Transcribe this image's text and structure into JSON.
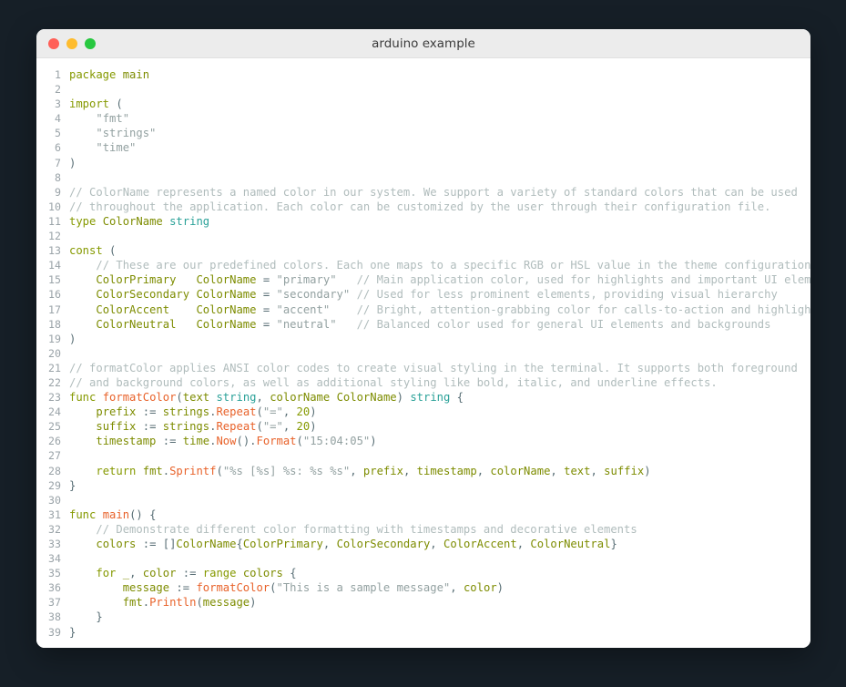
{
  "window": {
    "title": "arduino example",
    "controls": [
      {
        "name": "close-button",
        "color": "#ff5f57"
      },
      {
        "name": "minimize-button",
        "color": "#febc2e"
      },
      {
        "name": "maximize-button",
        "color": "#28c840"
      }
    ]
  },
  "theme": {
    "background": "#161f27",
    "titlebar": "#ececec",
    "editor_background": "#ffffff",
    "line_number": "#9aa3a8",
    "keyword": "#859900",
    "identifier": "#7d8c00",
    "builtin_type": "#2aa198",
    "function": "#e8622a",
    "string": "#93a1a1",
    "comment": "#b0bcbc",
    "punctuation": "#586e75"
  },
  "editor": {
    "language": "go",
    "first_line": 1,
    "last_line": 39,
    "lines": [
      {
        "n": 1,
        "tokens": [
          {
            "t": "package",
            "c": "kw"
          },
          {
            "t": " ",
            "c": "pun"
          },
          {
            "t": "main",
            "c": "id"
          }
        ]
      },
      {
        "n": 2,
        "tokens": []
      },
      {
        "n": 3,
        "tokens": [
          {
            "t": "import",
            "c": "kw"
          },
          {
            "t": " (",
            "c": "pun"
          }
        ]
      },
      {
        "n": 4,
        "tokens": [
          {
            "t": "    ",
            "c": "pun"
          },
          {
            "t": "\"fmt\"",
            "c": "str"
          }
        ]
      },
      {
        "n": 5,
        "tokens": [
          {
            "t": "    ",
            "c": "pun"
          },
          {
            "t": "\"strings\"",
            "c": "str"
          }
        ]
      },
      {
        "n": 6,
        "tokens": [
          {
            "t": "    ",
            "c": "pun"
          },
          {
            "t": "\"time\"",
            "c": "str"
          }
        ]
      },
      {
        "n": 7,
        "tokens": [
          {
            "t": ")",
            "c": "pun"
          }
        ]
      },
      {
        "n": 8,
        "tokens": []
      },
      {
        "n": 9,
        "tokens": [
          {
            "t": "// ColorName represents a named color in our system. We support a variety of standard colors that can be used",
            "c": "cmt"
          }
        ]
      },
      {
        "n": 10,
        "tokens": [
          {
            "t": "// throughout the application. Each color can be customized by the user through their configuration file.",
            "c": "cmt"
          }
        ]
      },
      {
        "n": 11,
        "tokens": [
          {
            "t": "type",
            "c": "kw"
          },
          {
            "t": " ",
            "c": "pun"
          },
          {
            "t": "ColorName",
            "c": "typ"
          },
          {
            "t": " ",
            "c": "pun"
          },
          {
            "t": "string",
            "c": "bt"
          }
        ]
      },
      {
        "n": 12,
        "tokens": []
      },
      {
        "n": 13,
        "tokens": [
          {
            "t": "const",
            "c": "kw"
          },
          {
            "t": " (",
            "c": "pun"
          }
        ]
      },
      {
        "n": 14,
        "tokens": [
          {
            "t": "    ",
            "c": "pun"
          },
          {
            "t": "// These are our predefined colors. Each one maps to a specific RGB or HSL value in the theme configuration.",
            "c": "cmt"
          }
        ]
      },
      {
        "n": 15,
        "tokens": [
          {
            "t": "    ",
            "c": "pun"
          },
          {
            "t": "ColorPrimary",
            "c": "id"
          },
          {
            "t": "   ",
            "c": "pun"
          },
          {
            "t": "ColorName",
            "c": "typ"
          },
          {
            "t": " = ",
            "c": "pun"
          },
          {
            "t": "\"primary\"",
            "c": "str"
          },
          {
            "t": "   ",
            "c": "pun"
          },
          {
            "t": "// Main application color, used for highlights and important UI elements",
            "c": "cmt"
          }
        ]
      },
      {
        "n": 16,
        "tokens": [
          {
            "t": "    ",
            "c": "pun"
          },
          {
            "t": "ColorSecondary",
            "c": "id"
          },
          {
            "t": " ",
            "c": "pun"
          },
          {
            "t": "ColorName",
            "c": "typ"
          },
          {
            "t": " = ",
            "c": "pun"
          },
          {
            "t": "\"secondary\"",
            "c": "str"
          },
          {
            "t": " ",
            "c": "pun"
          },
          {
            "t": "// Used for less prominent elements, providing visual hierarchy",
            "c": "cmt"
          }
        ]
      },
      {
        "n": 17,
        "tokens": [
          {
            "t": "    ",
            "c": "pun"
          },
          {
            "t": "ColorAccent",
            "c": "id"
          },
          {
            "t": "    ",
            "c": "pun"
          },
          {
            "t": "ColorName",
            "c": "typ"
          },
          {
            "t": " = ",
            "c": "pun"
          },
          {
            "t": "\"accent\"",
            "c": "str"
          },
          {
            "t": "    ",
            "c": "pun"
          },
          {
            "t": "// Bright, attention-grabbing color for calls-to-action and highlights",
            "c": "cmt"
          }
        ]
      },
      {
        "n": 18,
        "tokens": [
          {
            "t": "    ",
            "c": "pun"
          },
          {
            "t": "ColorNeutral",
            "c": "id"
          },
          {
            "t": "   ",
            "c": "pun"
          },
          {
            "t": "ColorName",
            "c": "typ"
          },
          {
            "t": " = ",
            "c": "pun"
          },
          {
            "t": "\"neutral\"",
            "c": "str"
          },
          {
            "t": "   ",
            "c": "pun"
          },
          {
            "t": "// Balanced color used for general UI elements and backgrounds",
            "c": "cmt"
          }
        ]
      },
      {
        "n": 19,
        "tokens": [
          {
            "t": ")",
            "c": "pun"
          }
        ]
      },
      {
        "n": 20,
        "tokens": []
      },
      {
        "n": 21,
        "tokens": [
          {
            "t": "// formatColor applies ANSI color codes to create visual styling in the terminal. It supports both foreground",
            "c": "cmt"
          }
        ]
      },
      {
        "n": 22,
        "tokens": [
          {
            "t": "// and background colors, as well as additional styling like bold, italic, and underline effects.",
            "c": "cmt"
          }
        ]
      },
      {
        "n": 23,
        "tokens": [
          {
            "t": "func",
            "c": "kw"
          },
          {
            "t": " ",
            "c": "pun"
          },
          {
            "t": "formatColor",
            "c": "fn"
          },
          {
            "t": "(",
            "c": "pun"
          },
          {
            "t": "text",
            "c": "id"
          },
          {
            "t": " ",
            "c": "pun"
          },
          {
            "t": "string",
            "c": "bt"
          },
          {
            "t": ", ",
            "c": "pun"
          },
          {
            "t": "colorName",
            "c": "id"
          },
          {
            "t": " ",
            "c": "pun"
          },
          {
            "t": "ColorName",
            "c": "typ"
          },
          {
            "t": ") ",
            "c": "pun"
          },
          {
            "t": "string",
            "c": "bt"
          },
          {
            "t": " {",
            "c": "pun"
          }
        ]
      },
      {
        "n": 24,
        "tokens": [
          {
            "t": "    ",
            "c": "pun"
          },
          {
            "t": "prefix",
            "c": "id"
          },
          {
            "t": " := ",
            "c": "pun"
          },
          {
            "t": "strings",
            "c": "id"
          },
          {
            "t": ".",
            "c": "pun"
          },
          {
            "t": "Repeat",
            "c": "fn"
          },
          {
            "t": "(",
            "c": "pun"
          },
          {
            "t": "\"=\"",
            "c": "str"
          },
          {
            "t": ", ",
            "c": "pun"
          },
          {
            "t": "20",
            "c": "num"
          },
          {
            "t": ")",
            "c": "pun"
          }
        ]
      },
      {
        "n": 25,
        "tokens": [
          {
            "t": "    ",
            "c": "pun"
          },
          {
            "t": "suffix",
            "c": "id"
          },
          {
            "t": " := ",
            "c": "pun"
          },
          {
            "t": "strings",
            "c": "id"
          },
          {
            "t": ".",
            "c": "pun"
          },
          {
            "t": "Repeat",
            "c": "fn"
          },
          {
            "t": "(",
            "c": "pun"
          },
          {
            "t": "\"=\"",
            "c": "str"
          },
          {
            "t": ", ",
            "c": "pun"
          },
          {
            "t": "20",
            "c": "num"
          },
          {
            "t": ")",
            "c": "pun"
          }
        ]
      },
      {
        "n": 26,
        "tokens": [
          {
            "t": "    ",
            "c": "pun"
          },
          {
            "t": "timestamp",
            "c": "id"
          },
          {
            "t": " := ",
            "c": "pun"
          },
          {
            "t": "time",
            "c": "id"
          },
          {
            "t": ".",
            "c": "pun"
          },
          {
            "t": "Now",
            "c": "fn"
          },
          {
            "t": "().",
            "c": "pun"
          },
          {
            "t": "Format",
            "c": "fn"
          },
          {
            "t": "(",
            "c": "pun"
          },
          {
            "t": "\"15:04:05\"",
            "c": "str"
          },
          {
            "t": ")",
            "c": "pun"
          }
        ]
      },
      {
        "n": 27,
        "tokens": []
      },
      {
        "n": 28,
        "tokens": [
          {
            "t": "    ",
            "c": "pun"
          },
          {
            "t": "return",
            "c": "kw"
          },
          {
            "t": " ",
            "c": "pun"
          },
          {
            "t": "fmt",
            "c": "id"
          },
          {
            "t": ".",
            "c": "pun"
          },
          {
            "t": "Sprintf",
            "c": "fn"
          },
          {
            "t": "(",
            "c": "pun"
          },
          {
            "t": "\"%s [%s] %s: %s %s\"",
            "c": "str"
          },
          {
            "t": ", ",
            "c": "pun"
          },
          {
            "t": "prefix",
            "c": "id"
          },
          {
            "t": ", ",
            "c": "pun"
          },
          {
            "t": "timestamp",
            "c": "id"
          },
          {
            "t": ", ",
            "c": "pun"
          },
          {
            "t": "colorName",
            "c": "id"
          },
          {
            "t": ", ",
            "c": "pun"
          },
          {
            "t": "text",
            "c": "id"
          },
          {
            "t": ", ",
            "c": "pun"
          },
          {
            "t": "suffix",
            "c": "id"
          },
          {
            "t": ")",
            "c": "pun"
          }
        ]
      },
      {
        "n": 29,
        "tokens": [
          {
            "t": "}",
            "c": "pun"
          }
        ]
      },
      {
        "n": 30,
        "tokens": []
      },
      {
        "n": 31,
        "tokens": [
          {
            "t": "func",
            "c": "kw"
          },
          {
            "t": " ",
            "c": "pun"
          },
          {
            "t": "main",
            "c": "fn"
          },
          {
            "t": "() {",
            "c": "pun"
          }
        ]
      },
      {
        "n": 32,
        "tokens": [
          {
            "t": "    ",
            "c": "pun"
          },
          {
            "t": "// Demonstrate different color formatting with timestamps and decorative elements",
            "c": "cmt"
          }
        ]
      },
      {
        "n": 33,
        "tokens": [
          {
            "t": "    ",
            "c": "pun"
          },
          {
            "t": "colors",
            "c": "id"
          },
          {
            "t": " := []",
            "c": "pun"
          },
          {
            "t": "ColorName",
            "c": "typ"
          },
          {
            "t": "{",
            "c": "pun"
          },
          {
            "t": "ColorPrimary",
            "c": "id"
          },
          {
            "t": ", ",
            "c": "pun"
          },
          {
            "t": "ColorSecondary",
            "c": "id"
          },
          {
            "t": ", ",
            "c": "pun"
          },
          {
            "t": "ColorAccent",
            "c": "id"
          },
          {
            "t": ", ",
            "c": "pun"
          },
          {
            "t": "ColorNeutral",
            "c": "id"
          },
          {
            "t": "}",
            "c": "pun"
          }
        ]
      },
      {
        "n": 34,
        "tokens": []
      },
      {
        "n": 35,
        "tokens": [
          {
            "t": "    ",
            "c": "pun"
          },
          {
            "t": "for",
            "c": "kw"
          },
          {
            "t": " ",
            "c": "pun"
          },
          {
            "t": "_",
            "c": "id"
          },
          {
            "t": ", ",
            "c": "pun"
          },
          {
            "t": "color",
            "c": "id"
          },
          {
            "t": " := ",
            "c": "pun"
          },
          {
            "t": "range",
            "c": "kw"
          },
          {
            "t": " ",
            "c": "pun"
          },
          {
            "t": "colors",
            "c": "id"
          },
          {
            "t": " {",
            "c": "pun"
          }
        ]
      },
      {
        "n": 36,
        "tokens": [
          {
            "t": "        ",
            "c": "pun"
          },
          {
            "t": "message",
            "c": "id"
          },
          {
            "t": " := ",
            "c": "pun"
          },
          {
            "t": "formatColor",
            "c": "fn"
          },
          {
            "t": "(",
            "c": "pun"
          },
          {
            "t": "\"This is a sample message\"",
            "c": "str"
          },
          {
            "t": ", ",
            "c": "pun"
          },
          {
            "t": "color",
            "c": "id"
          },
          {
            "t": ")",
            "c": "pun"
          }
        ]
      },
      {
        "n": 37,
        "tokens": [
          {
            "t": "        ",
            "c": "pun"
          },
          {
            "t": "fmt",
            "c": "id"
          },
          {
            "t": ".",
            "c": "pun"
          },
          {
            "t": "Println",
            "c": "fn"
          },
          {
            "t": "(",
            "c": "pun"
          },
          {
            "t": "message",
            "c": "id"
          },
          {
            "t": ")",
            "c": "pun"
          }
        ]
      },
      {
        "n": 38,
        "tokens": [
          {
            "t": "    }",
            "c": "pun"
          }
        ]
      },
      {
        "n": 39,
        "tokens": [
          {
            "t": "}",
            "c": "pun"
          }
        ]
      }
    ]
  }
}
